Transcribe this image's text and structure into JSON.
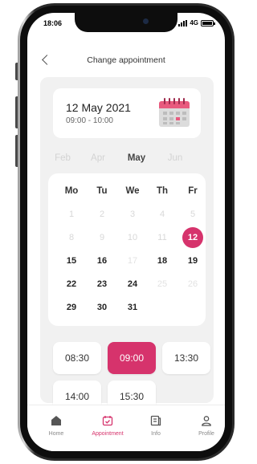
{
  "status_bar": {
    "time": "18:06",
    "network": "4G"
  },
  "header": {
    "title": "Change appointment"
  },
  "appointment": {
    "date": "12 May 2021",
    "time_range": "09:00 - 10:00"
  },
  "months": [
    {
      "label": "Feb",
      "active": false
    },
    {
      "label": "Apr",
      "active": false
    },
    {
      "label": "May",
      "active": true
    },
    {
      "label": "Jun",
      "active": false
    }
  ],
  "calendar": {
    "weekdays": [
      "Mo",
      "Tu",
      "We",
      "Th",
      "Fr"
    ],
    "weeks": [
      [
        "1",
        "2",
        "3",
        "4",
        "5"
      ],
      [
        "8",
        "9",
        "10",
        "11",
        "12"
      ],
      [
        "15",
        "16",
        "17",
        "18",
        "19"
      ],
      [
        "22",
        "23",
        "24",
        "25",
        "26"
      ],
      [
        "29",
        "30",
        "31",
        "",
        ""
      ]
    ],
    "available": [
      "15",
      "16",
      "18",
      "19",
      "22",
      "23",
      "24",
      "29",
      "30",
      "31"
    ],
    "selected": "12"
  },
  "time_slots": [
    {
      "label": "08:30",
      "active": false
    },
    {
      "label": "09:00",
      "active": true
    },
    {
      "label": "13:30",
      "active": false
    },
    {
      "label": "14:00",
      "active": false
    },
    {
      "label": "15:30",
      "active": false
    }
  ],
  "tabs": [
    {
      "label": "Home",
      "icon": "home-icon",
      "active": false
    },
    {
      "label": "Appointment",
      "icon": "calendar-check-icon",
      "active": true
    },
    {
      "label": "Info",
      "icon": "document-icon",
      "active": false
    },
    {
      "label": "Profile",
      "icon": "person-icon",
      "active": false
    }
  ],
  "colors": {
    "accent": "#d6336c",
    "panel": "#f1f1f1"
  }
}
